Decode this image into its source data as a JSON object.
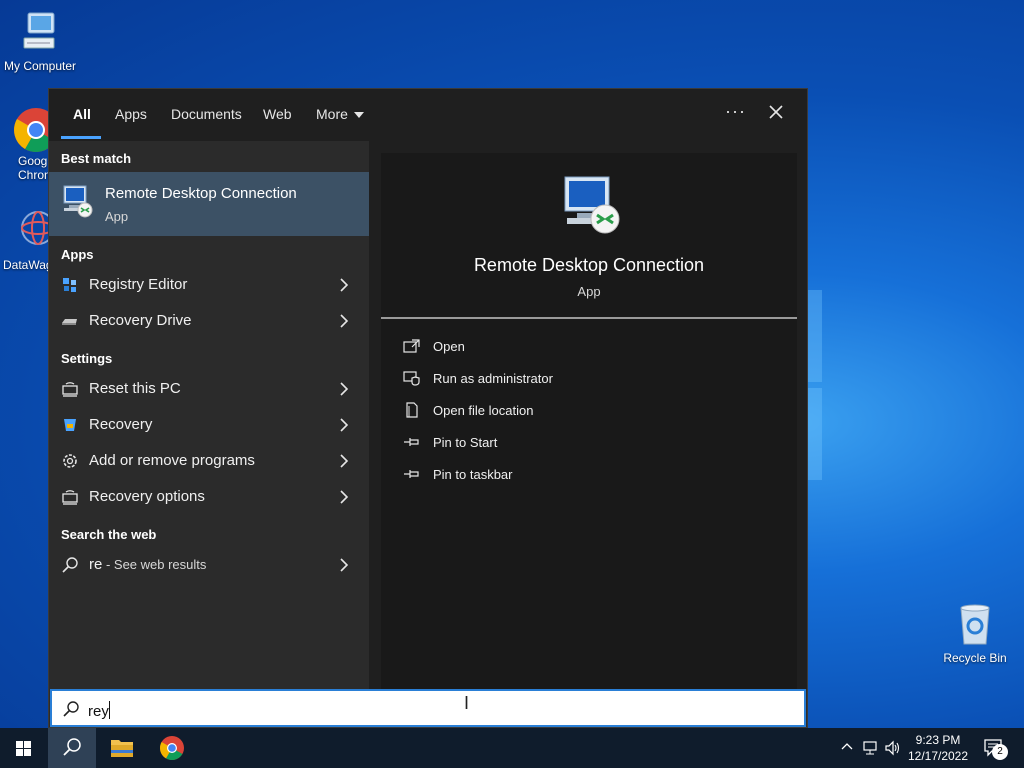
{
  "desktop": {
    "icons": [
      {
        "label": "My Computer"
      },
      {
        "label": "Goog\nChron"
      },
      {
        "label": "DataWag"
      },
      {
        "label": "Recycle Bin"
      }
    ]
  },
  "start_menu": {
    "tabs": [
      {
        "label": "All",
        "active": true
      },
      {
        "label": "Apps"
      },
      {
        "label": "Documents"
      },
      {
        "label": "Web"
      },
      {
        "label": "More"
      }
    ],
    "more_options_label": "···",
    "best_match": {
      "heading": "Best match",
      "title": "Remote Desktop Connection",
      "subtitle": "App"
    },
    "apps": {
      "heading": "Apps",
      "items": [
        {
          "label": "Registry Editor",
          "icon": "registry-icon"
        },
        {
          "label": "Recovery Drive",
          "icon": "drive-icon"
        }
      ]
    },
    "settings": {
      "heading": "Settings",
      "items": [
        {
          "label": "Reset this PC",
          "icon": "reset-pc-icon"
        },
        {
          "label": "Recovery",
          "icon": "recovery-icon"
        },
        {
          "label": "Add or remove programs",
          "icon": "gear-icon"
        },
        {
          "label": "Recovery options",
          "icon": "reset-pc-icon"
        }
      ]
    },
    "web": {
      "heading": "Search the web",
      "query": "re",
      "suffix": " - See web results"
    },
    "detail": {
      "title": "Remote Desktop Connection",
      "subtitle": "App",
      "actions": [
        {
          "label": "Open",
          "icon": "open-icon"
        },
        {
          "label": "Run as administrator",
          "icon": "shield-icon"
        },
        {
          "label": "Open file location",
          "icon": "file-location-icon"
        },
        {
          "label": "Pin to Start",
          "icon": "pin-icon"
        },
        {
          "label": "Pin to taskbar",
          "icon": "pin-icon"
        }
      ]
    }
  },
  "search": {
    "value": "rey"
  },
  "taskbar": {
    "time": "9:23 PM",
    "date": "12/17/2022",
    "notification_count": "2"
  },
  "colors": {
    "accent": "#4aa3ff",
    "best_match_bg": "#3c5165",
    "menu_bg": "#2b2b2b",
    "detail_bg": "#191919"
  }
}
